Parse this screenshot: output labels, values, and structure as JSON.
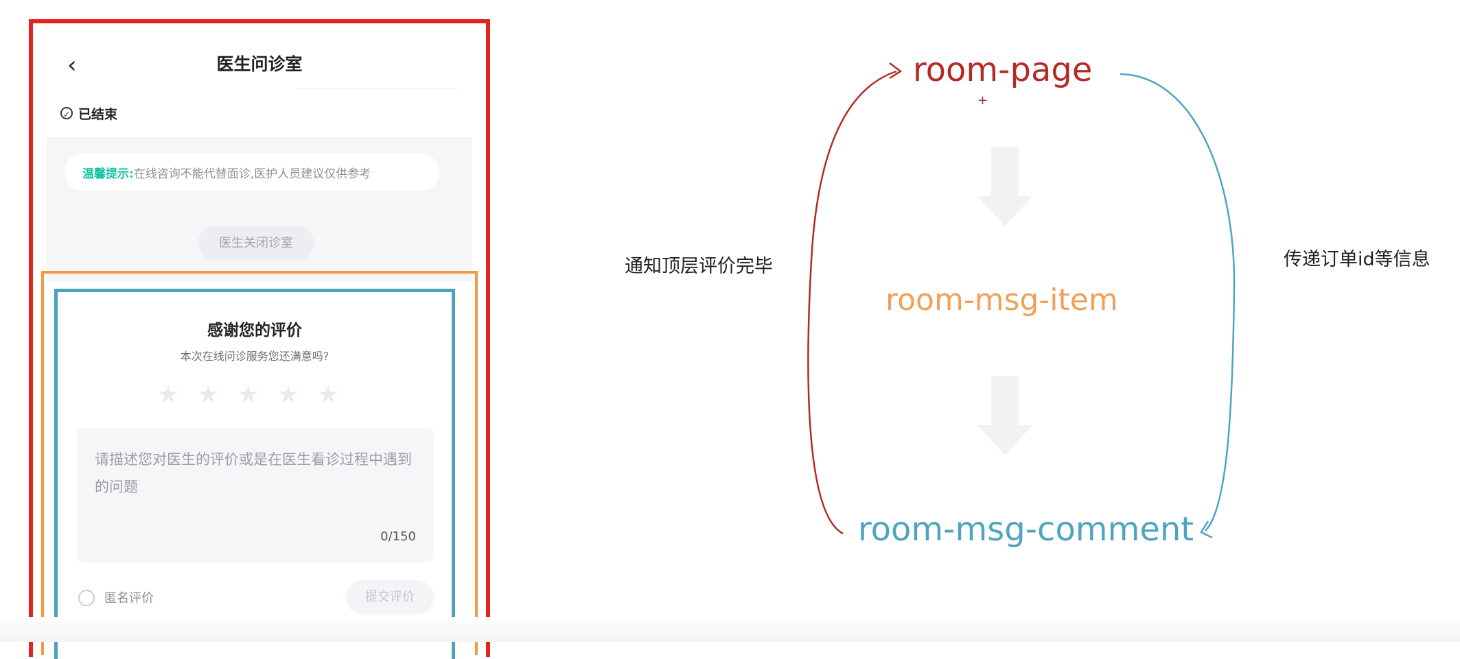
{
  "phone": {
    "nav": {
      "back_icon": "chevron-left-icon",
      "title": "医生问诊室"
    },
    "status": {
      "icon": "check-circle-icon",
      "text": "已结束"
    },
    "tip": {
      "label": "温馨提示:",
      "text": "在线咨询不能代替面诊,医护人员建议仅供参考"
    },
    "closed_notice": "医生关闭诊室",
    "comment": {
      "title": "感谢您的评价",
      "subtitle": "本次在线问诊服务您还满意吗?",
      "star_count": 5,
      "stars_selected": 0,
      "textarea_placeholder": "请描述您对医生的评价或是在医生看诊过程中遇到的问题",
      "char_count": "0/150",
      "anonymous_label": "匿名评价",
      "submit_label": "提交评价"
    }
  },
  "diagram": {
    "nodes": {
      "page": "room-page",
      "item": "room-msg-item",
      "comment": "room-msg-comment"
    },
    "labels": {
      "left": "通知顶层评价完毕",
      "right": "传递订单id等信息"
    },
    "colors": {
      "page": "#b32a26",
      "item": "#f0a058",
      "comment": "#4ea5bf",
      "red_box": "#e4241b",
      "orange_box": "#f39a45",
      "teal_box": "#4aa3b8"
    },
    "plus_mark": "+"
  }
}
